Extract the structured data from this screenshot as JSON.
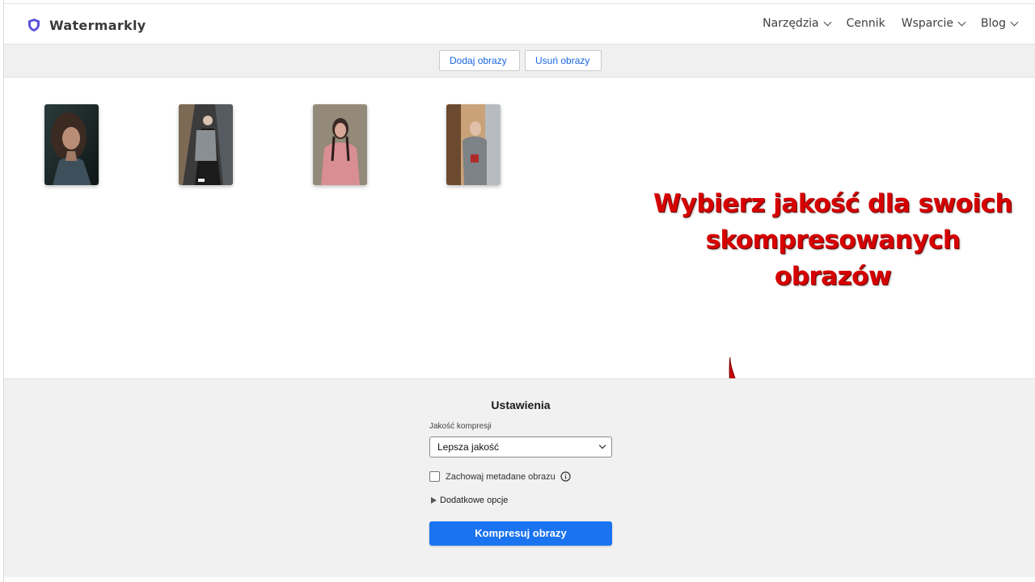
{
  "app": {
    "name": "Watermarkly",
    "logo_icon": "shield-icon",
    "accent_color": "#5b4fe0"
  },
  "nav": {
    "items": [
      {
        "label": "Narzędzia",
        "has_dropdown": true
      },
      {
        "label": "Cennik",
        "has_dropdown": false
      },
      {
        "label": "Wsparcie",
        "has_dropdown": true
      },
      {
        "label": "Blog",
        "has_dropdown": true
      }
    ]
  },
  "toolbar": {
    "add_label": "Dodaj obrazy",
    "remove_label": "Usuń obrazy"
  },
  "gallery": {
    "images": [
      {
        "name": "portrait-woman-dark-hair"
      },
      {
        "name": "woman-long-coat-city"
      },
      {
        "name": "woman-pink-jacket-braids"
      },
      {
        "name": "woman-grey-scarf-window"
      }
    ]
  },
  "callout": {
    "lines": [
      "Wybierz jakość dla swoich",
      "skompresowanych",
      "obrazów"
    ],
    "color": "#d60000"
  },
  "settings": {
    "title": "Ustawienia",
    "quality_label": "Jakość kompresji",
    "quality_value": "Lepsza jakość",
    "metadata_label": "Zachowaj metadane obrazu",
    "metadata_checked": false,
    "more_options_label": "Dodatkowe opcje",
    "compress_label": "Kompresuj obrazy",
    "button_color": "#1a73f0"
  }
}
